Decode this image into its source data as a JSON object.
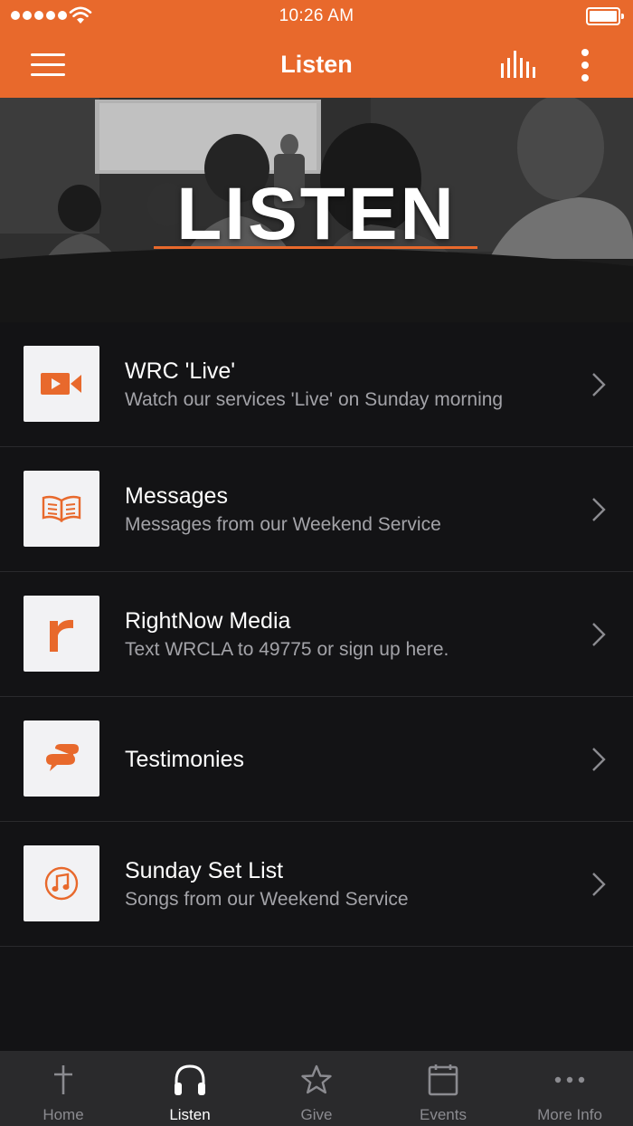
{
  "status_bar": {
    "time": "10:26 AM"
  },
  "header": {
    "title": "Listen"
  },
  "hero": {
    "title": "LISTEN"
  },
  "colors": {
    "accent": "#e8692c",
    "background": "#131315",
    "tabbar": "#2a2a2c"
  },
  "list": {
    "items": [
      {
        "title": "WRC 'Live'",
        "subtitle": "Watch our services 'Live' on Sunday morning",
        "icon": "video-camera-icon"
      },
      {
        "title": "Messages",
        "subtitle": "Messages from our Weekend Service",
        "icon": "open-book-icon"
      },
      {
        "title": "RightNow Media",
        "subtitle": "Text WRCLA to 49775 or sign up here.",
        "icon": "rightnow-logo-icon"
      },
      {
        "title": "Testimonies",
        "subtitle": "",
        "icon": "chat-bubbles-icon"
      },
      {
        "title": "Sunday Set List",
        "subtitle": "Songs from our Weekend Service",
        "icon": "music-note-icon"
      }
    ]
  },
  "tabbar": {
    "tabs": [
      {
        "label": "Home",
        "icon": "cross-icon",
        "active": false
      },
      {
        "label": "Listen",
        "icon": "headphones-icon",
        "active": true
      },
      {
        "label": "Give",
        "icon": "star-icon",
        "active": false
      },
      {
        "label": "Events",
        "icon": "calendar-icon",
        "active": false
      },
      {
        "label": "More Info",
        "icon": "ellipsis-icon",
        "active": false
      }
    ]
  }
}
